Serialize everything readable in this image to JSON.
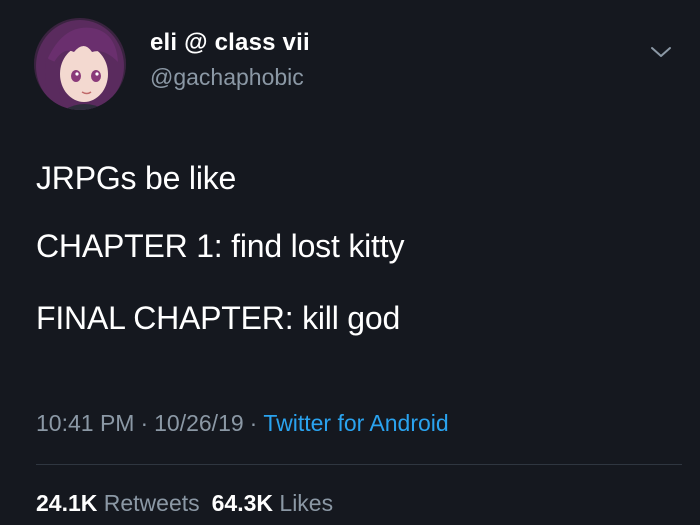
{
  "tweet": {
    "display_name": "eli @ class vii",
    "handle": "@gachaphobic",
    "lines": [
      "JRPGs be like",
      "CHAPTER 1: find lost kitty",
      "FINAL CHAPTER: kill god"
    ],
    "time": "10:41 PM",
    "date": "10/26/19",
    "separator": "·",
    "source": "Twitter for Android",
    "retweets_count": "24.1K",
    "retweets_label": "Retweets",
    "likes_count": "64.3K",
    "likes_label": "Likes"
  },
  "icons": {
    "menu": "chevron-down-icon",
    "avatar": "avatar"
  },
  "colors": {
    "background": "#15181f",
    "text": "#ffffff",
    "muted": "#8b98a5",
    "accent": "#2aa3ef"
  }
}
